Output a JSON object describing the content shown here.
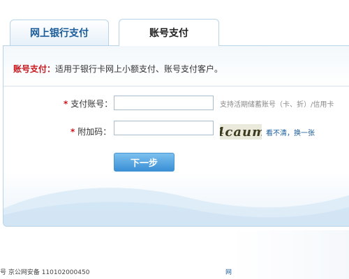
{
  "tabs": {
    "online_banking": "网上银行支付",
    "account_payment": "账号支付"
  },
  "notice": {
    "prefix": "账号支付：",
    "text": "适用于银行卡网上小额支付、账号支付客户。"
  },
  "form": {
    "required_mark": "*",
    "account_label": "支付账号：",
    "account_value": "",
    "account_hint": "支持活期储蓄账号（卡、折）/信用卡",
    "captcha_label": "附加码：",
    "captcha_value": "",
    "captcha_image_text": "4caum",
    "refresh_text": "看不清，换一张",
    "next_button": "下一步"
  },
  "footer": {
    "left_text": "号 京公网安备 110102000450",
    "right_text": "网"
  },
  "colors": {
    "accent": "#1a5b9a",
    "required_red": "#d0121b",
    "button_blue": "#3a8fd6"
  }
}
